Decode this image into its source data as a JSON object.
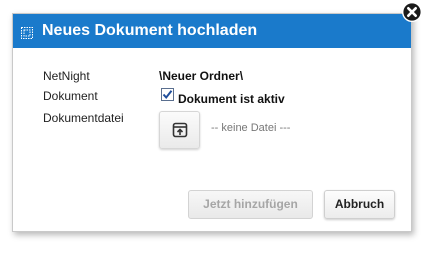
{
  "dialog": {
    "title": "Neues Dokument hochladen",
    "title_icon": "upload-dialog-icon",
    "close_icon": "close-icon"
  },
  "form": {
    "netnight_label": "NetNight",
    "netnight_value": "\\Neuer Ordner\\",
    "document_label": "Dokument",
    "active_checkbox_label": "Dokument ist aktiv",
    "active_checked": true,
    "file_label": "Dokumentdatei",
    "file_placeholder": "-- keine Datei ---",
    "upload_icon": "upload-icon"
  },
  "buttons": {
    "add_label": "Jetzt hinzufügen",
    "add_disabled": true,
    "cancel_label": "Abbruch"
  },
  "colors": {
    "titlebar": "#1a7acb",
    "checkbox": "#1f4e9c"
  }
}
